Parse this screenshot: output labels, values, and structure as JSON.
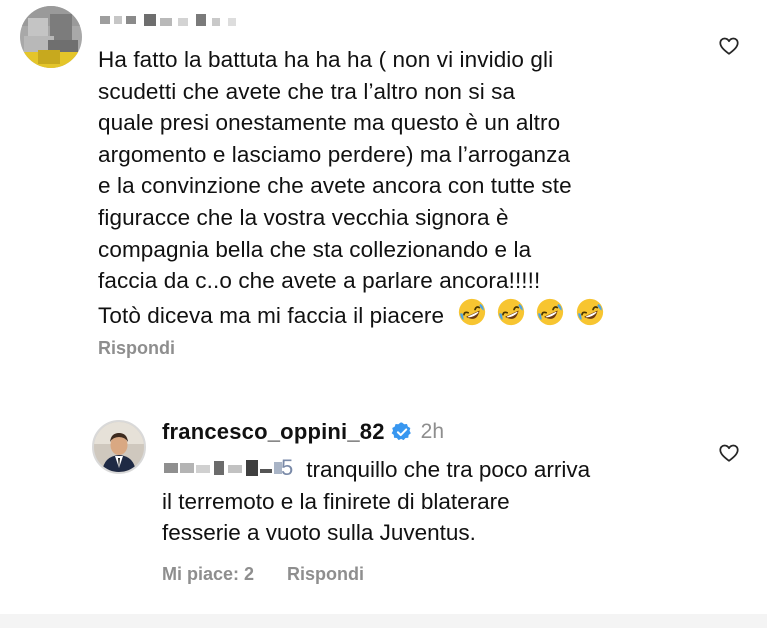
{
  "comment1": {
    "lines": [
      "Ha fatto la battuta ha ha ha ( non vi invidio gli",
      "scudetti che avete che tra l’altro non si sa",
      "quale presi onestamente ma questo è un altro",
      "argomento e lasciamo perdere) ma l’arroganza",
      "e la convinzione che avete ancora con tutte ste",
      "figuracce che la vostra vecchia signora è",
      "compagnia bella che sta collezionando e la",
      "faccia da c..o che avete a parlare ancora!!!!!",
      "Totò diceva ma mi faccia il piacere"
    ],
    "emoji_count": 4,
    "emoji_name": "rolling-on-the-floor-laughing",
    "reply_label": "Rispondi"
  },
  "comment2": {
    "username": "francesco_oppini_82",
    "verified": true,
    "time": "2h",
    "mention_tail": "5",
    "line1_rest": " tranquillo che tra poco arriva",
    "lines": [
      "il terremoto e la finirete di blaterare",
      "fesserie a vuoto sulla Juventus."
    ],
    "likes_label": "Mi piace: 2",
    "reply_label": "Rispondi"
  },
  "colors": {
    "text": "#111111",
    "muted": "#8e8e8e",
    "verified_blue": "#3897f0",
    "emoji_yellow": "#f7c531"
  },
  "icons": [
    "heart-icon",
    "verified-badge-icon",
    "laughing-emoji-icon"
  ]
}
